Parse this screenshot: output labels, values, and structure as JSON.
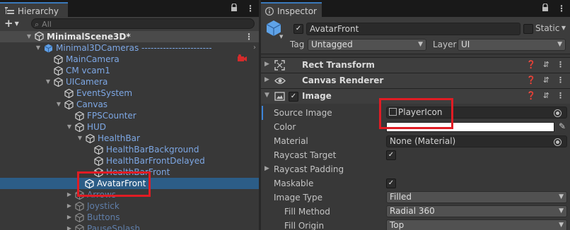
{
  "hierarchy": {
    "tab_label": "Hierarchy",
    "add_label": "+",
    "search_placeholder": "All",
    "rows": [
      {
        "label": "MinimalScene3D*"
      },
      {
        "label": "Minimal3DCameras -----------------------"
      },
      {
        "label": "MainCamera"
      },
      {
        "label": "CM vcam1"
      },
      {
        "label": "UICamera"
      },
      {
        "label": "EventSystem"
      },
      {
        "label": "Canvas"
      },
      {
        "label": "FPSCounter"
      },
      {
        "label": "HUD"
      },
      {
        "label": "HealthBar"
      },
      {
        "label": "HealthBarBackground"
      },
      {
        "label": "HealthBarFrontDelayed"
      },
      {
        "label": "HealthBarFront"
      },
      {
        "label": "AvatarFront"
      },
      {
        "label": "Arrows"
      },
      {
        "label": "Joystick"
      },
      {
        "label": "Buttons"
      },
      {
        "label": "PauseSplash"
      }
    ]
  },
  "inspector": {
    "tab_label": "Inspector",
    "object_name": "AvatarFront",
    "static_label": "Static",
    "tag_label": "Tag",
    "tag_value": "Untagged",
    "layer_label": "Layer",
    "layer_value": "UI",
    "components": [
      {
        "name": "Rect Transform"
      },
      {
        "name": "Canvas Renderer"
      },
      {
        "name": "Image"
      }
    ],
    "properties": {
      "source_image_label": "Source Image",
      "source_image_value": "PlayerIcon",
      "color_label": "Color",
      "color_value": "#ffffff",
      "material_label": "Material",
      "material_value": "None (Material)",
      "raycast_target_label": "Raycast Target",
      "raycast_padding_label": "Raycast Padding",
      "maskable_label": "Maskable",
      "image_type_label": "Image Type",
      "image_type_value": "Filled",
      "fill_method_label": "Fill Method",
      "fill_method_value": "Radial 360",
      "fill_origin_label": "Fill Origin",
      "fill_origin_value": "Top"
    }
  },
  "icons": {
    "lock": "lock-icon",
    "menu": "kebab-menu-icon",
    "cube": "gameobject-cube-icon",
    "warning": "camera-warning-icon",
    "search": "search-icon"
  },
  "colors": {
    "selection": "#2c5d87",
    "highlight_box": "#e01c24",
    "text_blue": "#7da7e4"
  }
}
